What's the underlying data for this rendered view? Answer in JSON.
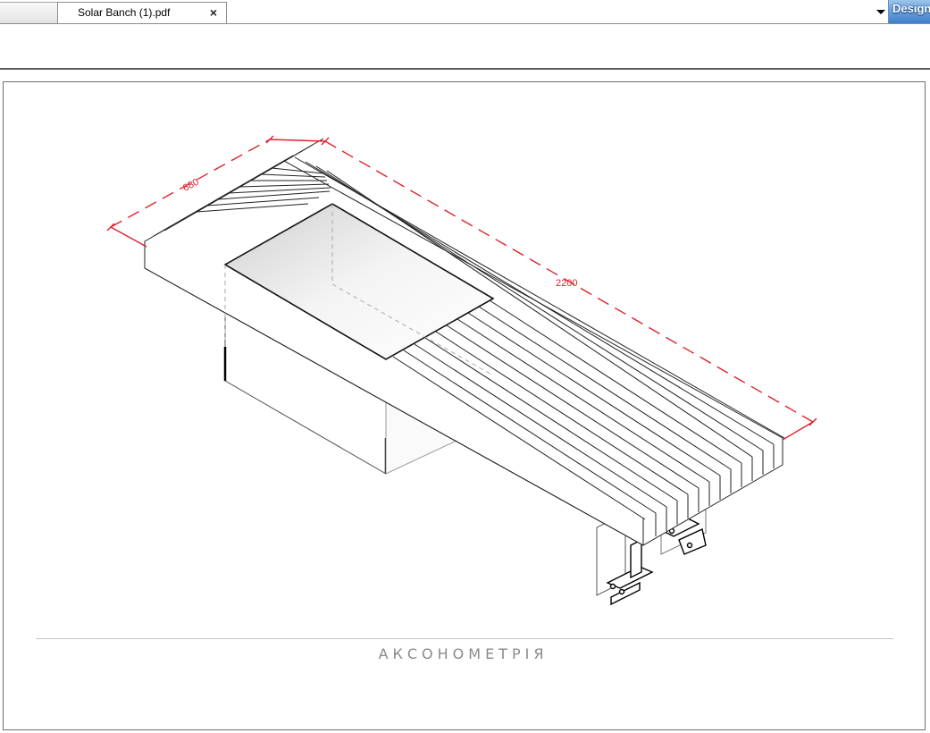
{
  "tabs": [
    {
      "label": ""
    },
    {
      "label": "Solar Banch (1).pdf",
      "close_glyph": "×",
      "active": true
    }
  ],
  "toolbar": {
    "dropdown_icon": "chevron-down-icon",
    "design_button_label": "Design"
  },
  "drawing": {
    "dim_width_label": "680",
    "dim_length_label": "2200",
    "caption": "АКСОНОМЕТРІЯ",
    "dimension_color": "#e0222c"
  }
}
